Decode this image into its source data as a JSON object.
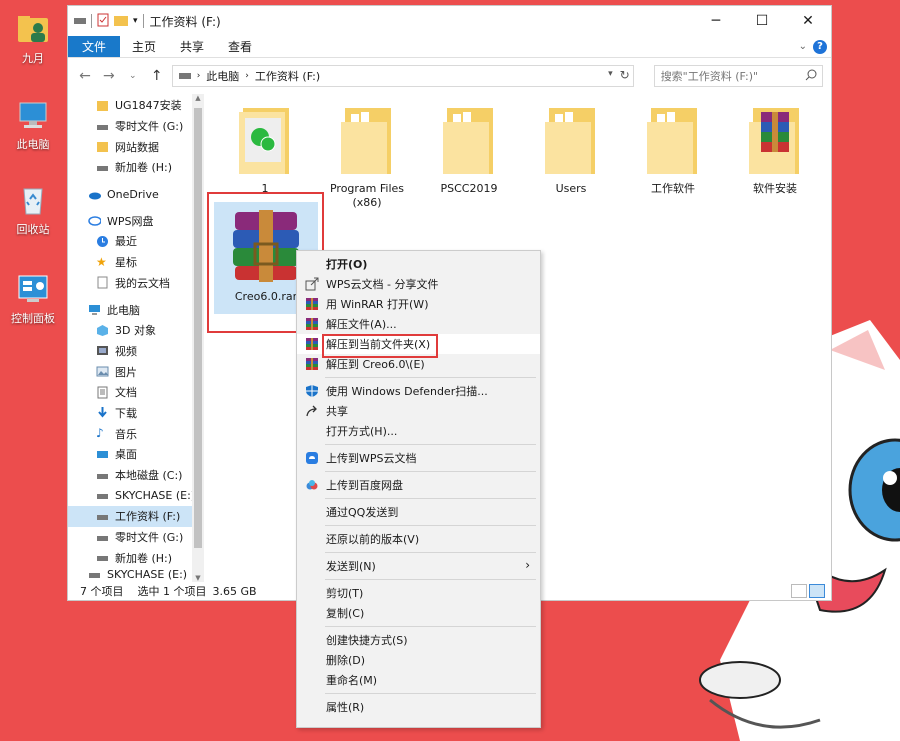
{
  "desktop": {
    "icons": [
      {
        "label": "九月",
        "icon": "user-folder-icon"
      },
      {
        "label": "此电脑",
        "icon": "computer-icon"
      },
      {
        "label": "回收站",
        "icon": "recycle-bin-icon"
      },
      {
        "label": "控制面板",
        "icon": "control-panel-icon"
      }
    ]
  },
  "window": {
    "title": "工作资料 (F:)",
    "ribbon_tabs": [
      "文件",
      "主页",
      "共享",
      "查看"
    ],
    "address": {
      "crumbs": [
        "此电脑",
        "工作资料 (F:)"
      ]
    },
    "search_placeholder": "搜索\"工作资料 (F:)\"",
    "nav_items": [
      {
        "label": "UG1847安装",
        "icon": "folder-icon"
      },
      {
        "label": "零时文件 (G:)",
        "icon": "drive-icon"
      },
      {
        "label": "网站数据",
        "icon": "folder-icon"
      },
      {
        "label": "新加卷 (H:)",
        "icon": "drive-icon"
      },
      {
        "label": "OneDrive",
        "icon": "cloud-icon"
      },
      {
        "label": "WPS网盘",
        "icon": "wps-cloud-icon"
      },
      {
        "label": "最近",
        "icon": "clock-icon"
      },
      {
        "label": "星标",
        "icon": "star-icon"
      },
      {
        "label": "我的云文档",
        "icon": "document-icon"
      },
      {
        "label": "此电脑",
        "icon": "computer-icon"
      },
      {
        "label": "3D 对象",
        "icon": "3d-objects-icon"
      },
      {
        "label": "视频",
        "icon": "video-icon"
      },
      {
        "label": "图片",
        "icon": "pictures-icon"
      },
      {
        "label": "文档",
        "icon": "documents-icon"
      },
      {
        "label": "下载",
        "icon": "download-icon"
      },
      {
        "label": "音乐",
        "icon": "music-icon"
      },
      {
        "label": "桌面",
        "icon": "desktop-icon"
      },
      {
        "label": "本地磁盘 (C:)",
        "icon": "drive-icon"
      },
      {
        "label": "SKYCHASE (E:)",
        "icon": "drive-icon"
      },
      {
        "label": "工作资料 (F:)",
        "icon": "drive-icon",
        "selected": true
      },
      {
        "label": "零时文件 (G:)",
        "icon": "drive-icon"
      },
      {
        "label": "新加卷 (H:)",
        "icon": "drive-icon"
      },
      {
        "label": "SKYCHASE (E:)",
        "icon": "drive-icon"
      }
    ],
    "files": [
      {
        "name": "1",
        "icon": "wechat-folder-icon"
      },
      {
        "name": "Program Files (x86)",
        "icon": "folder-icon"
      },
      {
        "name": "PSCC2019",
        "icon": "folder-icon"
      },
      {
        "name": "Users",
        "icon": "folder-icon"
      },
      {
        "name": "工作软件",
        "icon": "folder-icon"
      },
      {
        "name": "软件安装",
        "icon": "winrar-folder-icon"
      },
      {
        "name": "Creo6.0.rar",
        "icon": "winrar-archive-icon",
        "selected": true
      }
    ],
    "status": {
      "count": "7 个项目",
      "selection": "选中 1 个项目",
      "size": "3.65 GB"
    }
  },
  "context_menu": {
    "items": [
      {
        "label": "打开(O)",
        "bold": true
      },
      {
        "label": "WPS云文档 - 分享文件",
        "icon": "share-out-icon"
      },
      {
        "label": "用 WinRAR 打开(W)",
        "icon": "winrar-icon"
      },
      {
        "label": "解压文件(A)...",
        "icon": "winrar-icon"
      },
      {
        "label": "解压到当前文件夹(X)",
        "icon": "winrar-icon",
        "highlighted": true
      },
      {
        "label": "解压到 Creo6.0\\(E)",
        "icon": "winrar-icon"
      },
      {
        "sep": true
      },
      {
        "label": "使用 Windows Defender扫描...",
        "icon": "defender-shield-icon"
      },
      {
        "label": "共享",
        "icon": "share-icon"
      },
      {
        "label": "打开方式(H)..."
      },
      {
        "sep": true
      },
      {
        "label": "上传到WPS云文档",
        "icon": "wps-cloud-icon"
      },
      {
        "sep": true
      },
      {
        "label": "上传到百度网盘",
        "icon": "baidu-cloud-icon"
      },
      {
        "sep": true
      },
      {
        "label": "通过QQ发送到"
      },
      {
        "sep": true
      },
      {
        "label": "还原以前的版本(V)"
      },
      {
        "sep": true
      },
      {
        "label": "发送到(N)",
        "submenu": true
      },
      {
        "sep": true
      },
      {
        "label": "剪切(T)"
      },
      {
        "label": "复制(C)"
      },
      {
        "sep": true
      },
      {
        "label": "创建快捷方式(S)"
      },
      {
        "label": "删除(D)"
      },
      {
        "label": "重命名(M)"
      },
      {
        "sep": true
      },
      {
        "label": "属性(R)"
      }
    ]
  },
  "colors": {
    "desktop_bg": "#ec4d4d",
    "accent": "#1979ca",
    "annotation": "#e03b3b"
  }
}
